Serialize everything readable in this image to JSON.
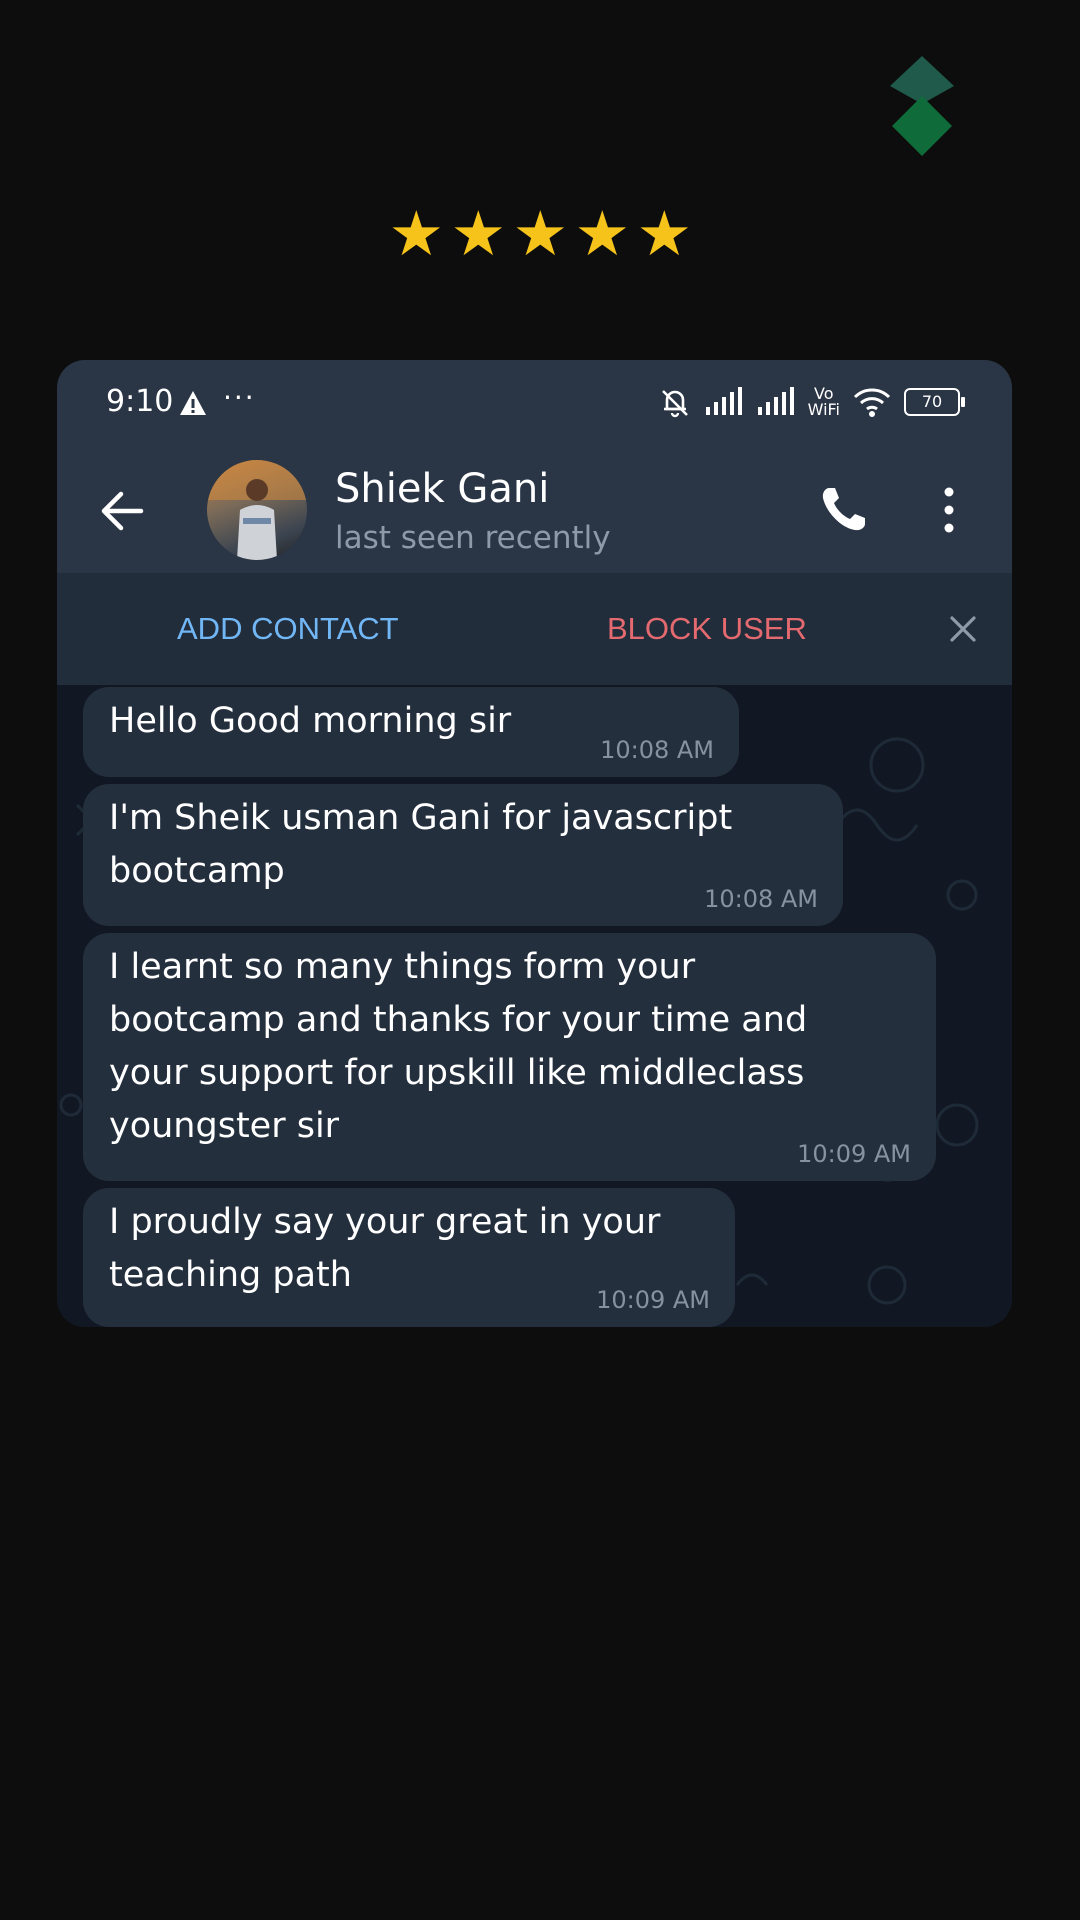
{
  "header": {
    "rating": [
      "★",
      "★",
      "★",
      "★",
      "★"
    ],
    "rating_value": 5,
    "rating_max": 5,
    "star_color": "#f6c31a"
  },
  "status_bar": {
    "time": "9:10",
    "more": "···",
    "vowifi_top": "Vo",
    "vowifi_bottom": "WiFi",
    "battery": "70"
  },
  "chat_header": {
    "name": "Shiek Gani",
    "status": "last seen recently"
  },
  "action_bar": {
    "add_contact": "ADD CONTACT",
    "block_user": "BLOCK USER",
    "add_color": "#72b7f5",
    "block_color": "#e46a70"
  },
  "messages": [
    {
      "text": "Hello Good morning sir",
      "time": "10:08 AM"
    },
    {
      "text": "I'm Sheik usman Gani for javascript\nbootcamp",
      "time": "10:08 AM"
    },
    {
      "text": "I learnt so many things form your\nbootcamp and thanks for your time and\nyour support for upskill like middleclass\nyoungster sir",
      "time": "10:09 AM"
    },
    {
      "text": "I proudly say your great in your\nteaching path",
      "time": "10:09 AM"
    }
  ],
  "icons": [
    "brand-logo-icon",
    "warning-icon",
    "silent-bell-icon",
    "signal-icon",
    "wifi-icon",
    "back-arrow-icon",
    "phone-icon",
    "more-vertical-icon",
    "close-icon"
  ]
}
